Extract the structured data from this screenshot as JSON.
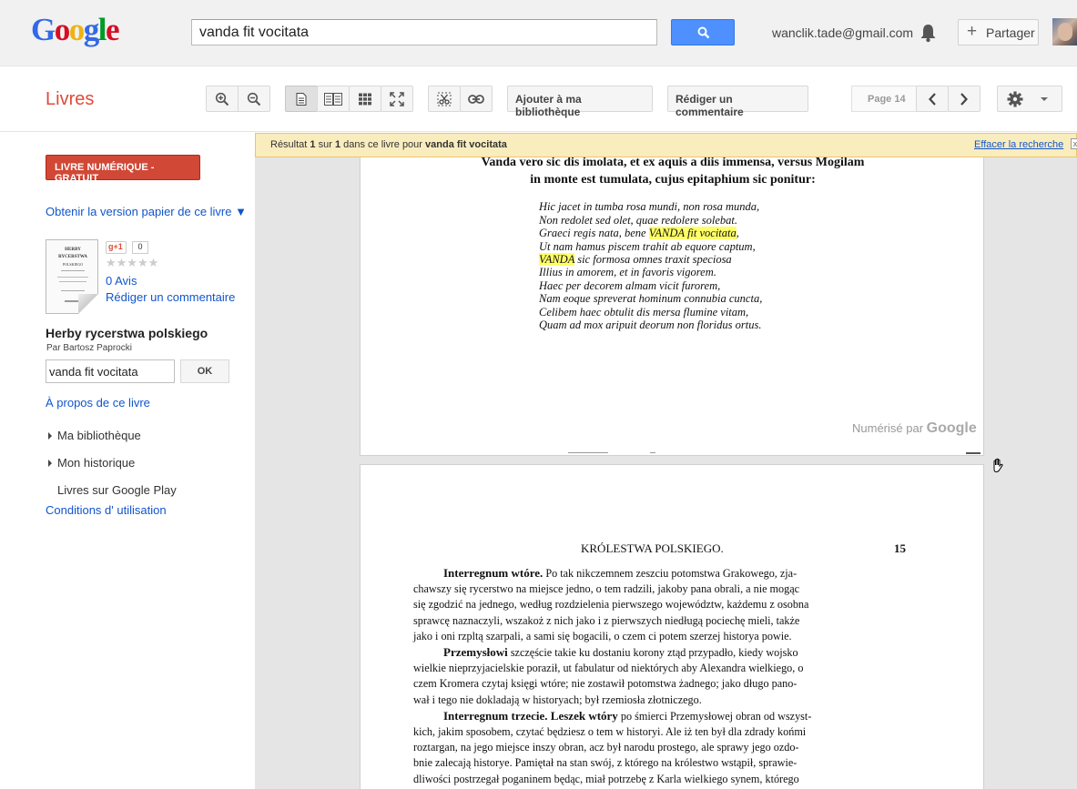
{
  "header": {
    "logo_letters": [
      "G",
      "o",
      "o",
      "g",
      "l",
      "e"
    ],
    "search_query": "vanda fit vocitata",
    "user_email": "wanclik.tade@gmail.com",
    "share_label": "Partager",
    "icons": [
      "search-icon",
      "bell-icon",
      "plus-icon",
      "avatar"
    ]
  },
  "toolbar": {
    "section_title": "Livres",
    "add_library_label": "Ajouter à ma bibliothèque",
    "write_review_label": "Rédiger un commentaire",
    "page_indicator": "Page 14",
    "icons": [
      "zoom-in-icon",
      "zoom-out-icon",
      "single-page-icon",
      "two-page-icon",
      "thumbnail-icon",
      "fullscreen-icon",
      "clip-icon",
      "link-icon",
      "chevron-left-icon",
      "chevron-right-icon",
      "gear-icon"
    ]
  },
  "sidebar": {
    "buy_button": "LIVRE NUMÉRIQUE - GRATUIT",
    "get_paper": "Obtenir la version papier de ce livre ▼",
    "gplus_label": "+1",
    "gplus_count": "0",
    "stars": "★★★★★",
    "reviews_count": "0 Avis",
    "write_review": "Rédiger un commentaire",
    "book_title": "Herby rycerstwa polskiego",
    "book_author": "Par Bartosz Paprocki",
    "in_book_search": "vanda fit vocitata",
    "ok_label": "OK",
    "about_link": "À propos de ce livre",
    "nav_items": [
      "Ma bibliothèque",
      "Mon historique",
      "Livres sur Google Play"
    ],
    "conditions_link": "Conditions d' utilisation",
    "cover_lines": [
      "HERBY",
      "RYCERSTWA",
      "POLSKIEGO"
    ]
  },
  "result_bar": {
    "prefix": "Résultat ",
    "current": "1",
    "middle": " sur ",
    "total": "1",
    "suffix": " dans ce livre pour ",
    "query": "vanda fit vocitata",
    "clear_link": "Effacer la recherche",
    "close": "x"
  },
  "page14": {
    "heading_lines": [
      "Vanda vero sic dis imolata, et ex aquis a diis immensa, versus Mogilam",
      "in monte est tumulata, cujus epitaphium sic ponitur:"
    ],
    "verse_1": "Hic jacet in tumba rosa mundi, non rosa munda,",
    "verse_2": "Non redolet sed olet, quae redolere solebat.",
    "verse_3_before": "Graeci regis nata, bene ",
    "verse_3_highlight": "VANDA fit vocitata",
    "verse_3_after": ",",
    "verse_4": "Ut nam hamus piscem trahit ab equore captum,",
    "verse_5_highlight": "VANDA",
    "verse_5_after": " sic formosa omnes traxit speciosa",
    "verse_6": "Illius in amorem, et in favoris vigorem.",
    "verse_7": "Haec per decorem almam vicit furorem,",
    "verse_8": "Nam eoque spreverat hominum connubia cuncta,",
    "verse_9": "Celibem haec obtulit dis mersa flumine vitam,",
    "verse_10": "Quam ad mox aripuit deorum non floridus ortus.",
    "digitized_prefix": "Numérisé par ",
    "digitized_brand": "Google"
  },
  "page15": {
    "running_head": "KRÓLESTWA POLSKIEGO.",
    "page_number": "15",
    "para1_bold": "Interregnum wtóre.",
    "para1_l1": " Po tak nikczemnem zeszciu potomstwa Grakowego, zja-",
    "para1_l2": "chawszy się rycerstwo na miejsce jedno, o tem radzili, jakoby pana obrali, a nie mogąc",
    "para1_l3": "się zgodzić na jednego, według rozdzielenia pierwszego województw, każdemu z osobna",
    "para1_l4": "sprawcę naznaczyli, wszakoż z nich jako i z pierwszych niedługą pociechę mieli, także",
    "para1_l5": "jako i oni rzpltą szarpali, a sami się bogacili, o czem ci potem szerzej historya powie.",
    "para2_bold": "Przemysłowi",
    "para2_l1": " szczęście takie ku dostaniu korony ztąd przypadło, kiedy wojsko",
    "para2_l2": "wielkie nieprzyjacielskie poraził, ut fabulatur od niektórych aby Alexandra wielkiego, o",
    "para2_l3": "czem Kromera czytaj księgi wtóre; nie zostawił potomstwa żadnego; jako długo pano-",
    "para2_l4": "wał i tego nie dokladają w historyach; był rzemiosła złotniczego.",
    "para3_bold": "Interregnum trzecie. Leszek wtóry",
    "para3_l1": " po śmierci Przemysłowej obran od wszyst-",
    "para3_l2": "kich, jakim sposobem, czytać będziesz o tem w historyi. Ale iż ten był dla zdrady końmi",
    "para3_l3": "roztargan, na jego miejsce inszy obran, acz był narodu prostego, ale sprawy jego ozdo-",
    "para3_l4": "bnie zalecają historye. Pamiętał na stan swój, z którego na królestwo wstąpił, sprawie-",
    "para3_l5": "dliwości postrzegał poganinem będąc, miał potrzebę z Karla wielkiego synem, którego"
  },
  "colors": {
    "brand_red": "#dd4b39",
    "link_blue": "#1155cc",
    "search_blue": "#4d90fe",
    "result_bar_bg": "#f9edbe",
    "highlight": "#ffff66"
  }
}
